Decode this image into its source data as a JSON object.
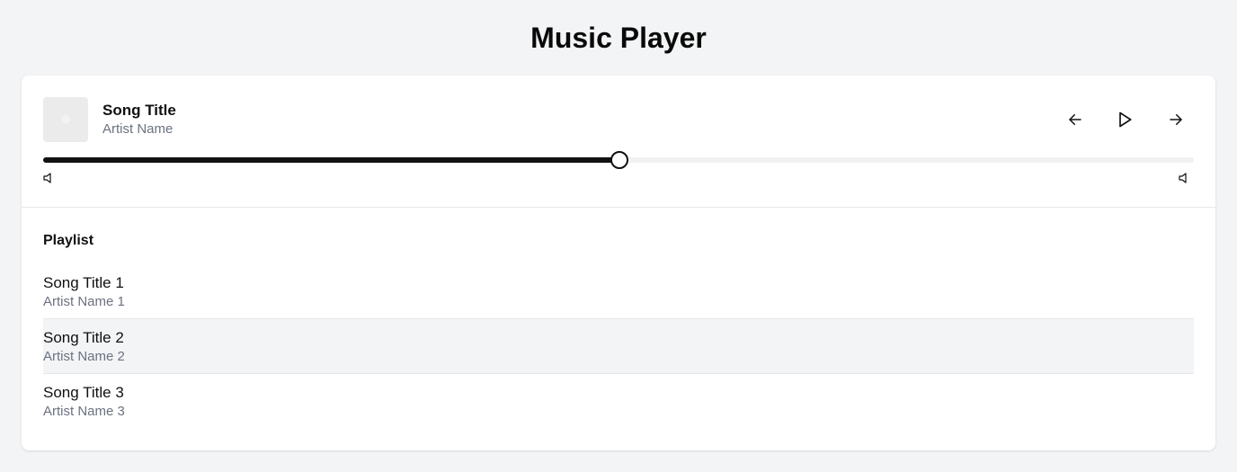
{
  "app": {
    "title": "Music Player"
  },
  "now_playing": {
    "song_title": "Song Title",
    "artist_name": "Artist Name",
    "progress_fraction": 0.5,
    "controls": {
      "previous_icon": "arrow-left-icon",
      "play_icon": "play-icon",
      "next_icon": "arrow-right-icon"
    },
    "volume_icons": [
      "volume-low-icon",
      "volume-high-icon"
    ]
  },
  "playlist": {
    "heading": "Playlist",
    "active_index": 1,
    "items": [
      {
        "title": "Song Title 1",
        "artist": "Artist Name 1"
      },
      {
        "title": "Song Title 2",
        "artist": "Artist Name 2"
      },
      {
        "title": "Song Title 3",
        "artist": "Artist Name 3"
      }
    ]
  },
  "colors": {
    "background": "#f3f4f6",
    "card": "#ffffff",
    "accent": "#111111",
    "muted_text": "#6b7280",
    "active_row": "#f3f4f6"
  }
}
